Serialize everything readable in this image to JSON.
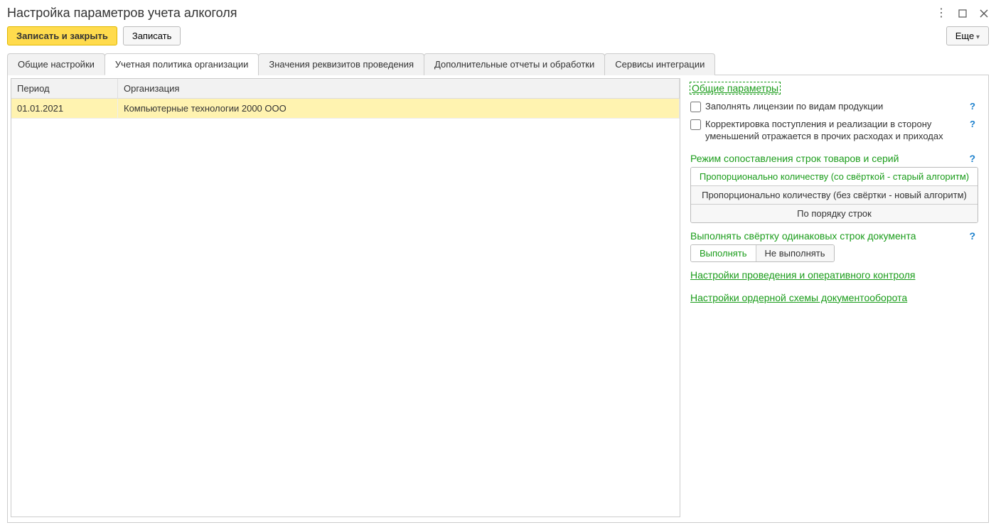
{
  "window": {
    "title": "Настройка параметров учета алкоголя"
  },
  "toolbar": {
    "save_close": "Записать и закрыть",
    "save": "Записать",
    "more": "Еще"
  },
  "tabs": [
    {
      "label": "Общие настройки",
      "active": false
    },
    {
      "label": "Учетная политика организации",
      "active": true
    },
    {
      "label": "Значения реквизитов проведения",
      "active": false
    },
    {
      "label": "Дополнительные отчеты и обработки",
      "active": false
    },
    {
      "label": "Сервисы интеграции",
      "active": false
    }
  ],
  "table": {
    "columns": {
      "period": "Период",
      "org": "Организация"
    },
    "rows": [
      {
        "period": "01.01.2021",
        "org": "Компьютерные технологии 2000 ООО"
      }
    ]
  },
  "side": {
    "general_params": "Общие параметры",
    "cb_licenses": "Заполнять лицензии по видам продукции",
    "cb_correction": "Корректировка поступления и реализации в сторону уменьшений отражается в прочих расходах и приходах",
    "mode_title": "Режим сопоставления строк товаров и серий",
    "mode_options": [
      "Пропорционально количеству (со свёрткой - старый алгоритм)",
      "Пропорционально количеству (без свёртки - новый алгоритм)",
      "По порядку строк"
    ],
    "collapse_title": "Выполнять свёртку одинаковых строк документа",
    "collapse_options": [
      "Выполнять",
      "Не выполнять"
    ],
    "link_posting": "Настройки проведения и оперативного контроля",
    "link_order_scheme": "Настройки ордерной схемы документооборота",
    "help": "?"
  }
}
